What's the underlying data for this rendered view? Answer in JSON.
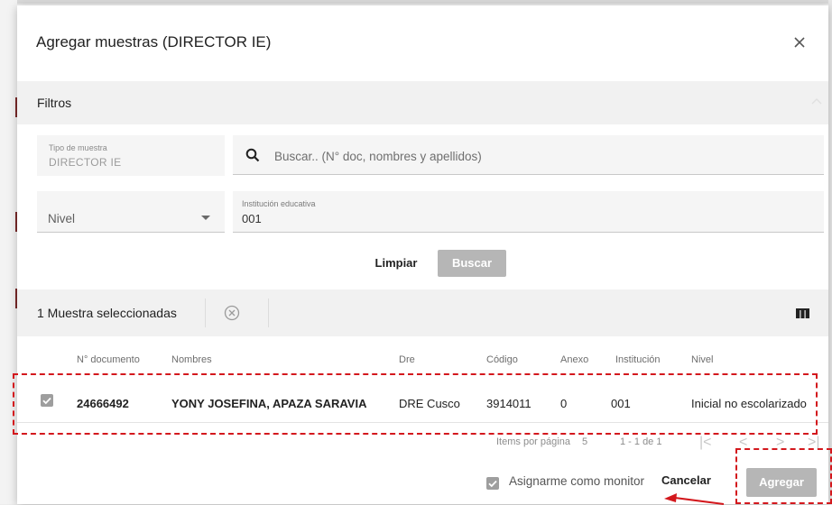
{
  "dialog": {
    "title": "Agregar muestras (DIRECTOR IE)"
  },
  "filters": {
    "section_label": "Filtros",
    "tipo_muestra_label": "Tipo de muestra",
    "tipo_muestra_value": "DIRECTOR IE",
    "search_placeholder": "Buscar.. (N° doc, nombres y apellidos)",
    "nivel_label": "Nivel",
    "institucion_label": "Institución educativa",
    "institucion_value": "001",
    "limpiar_label": "Limpiar",
    "buscar_label": "Buscar"
  },
  "selection": {
    "summary": "1 Muestra seleccionadas"
  },
  "table": {
    "headers": [
      "N° documento",
      "Nombres",
      "Dre",
      "Código",
      "Anexo",
      "Institución",
      "Nivel"
    ],
    "rows": [
      {
        "selected": true,
        "documento": "24666492",
        "nombres": "YONY JOSEFINA, APAZA SARAVIA",
        "dre": "DRE Cusco",
        "codigo": "3914011",
        "anexo": "0",
        "institucion": "001",
        "nivel": "Inicial no escolarizado"
      }
    ]
  },
  "pagination": {
    "items_per_page_label": "Items por página",
    "items_per_page_value": "5",
    "range": "1 - 1 de 1"
  },
  "footer": {
    "monitor_checked": true,
    "monitor_label": "Asignarme como monitor",
    "cancel_label": "Cancelar",
    "add_label": "Agregar"
  },
  "colors": {
    "annotation_red": "#d3181d",
    "disabled_button": "#b6b6b6",
    "panel_bg": "#f1f1f1"
  },
  "icons": [
    "close-icon",
    "chevron-up-icon",
    "search-icon",
    "caret-down-icon",
    "clear-circle-icon",
    "columns-icon",
    "check-icon",
    "first-page-icon",
    "prev-page-icon",
    "next-page-icon",
    "last-page-icon"
  ]
}
